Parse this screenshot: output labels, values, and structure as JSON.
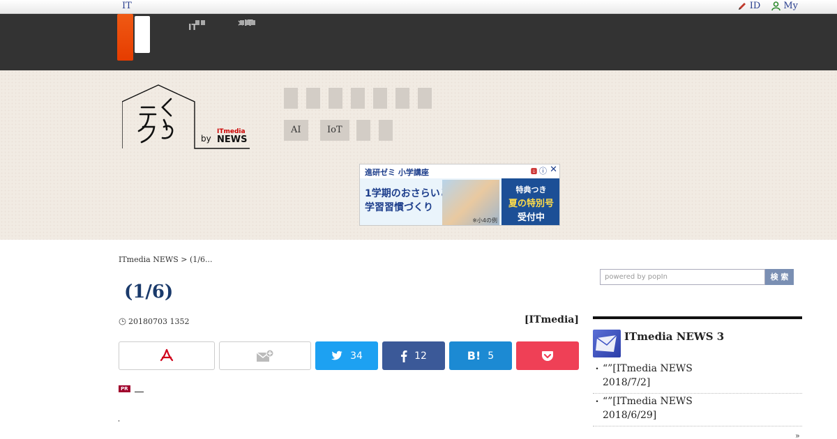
{
  "topbar": {
    "left_link": "IT",
    "id_link": "ID",
    "my_link": "My"
  },
  "nav": {
    "item1_line1": "",
    "item1_line2": "IT",
    "item2_line1": "",
    "item2_line2": "×IT"
  },
  "banner": {
    "logo_text_by": "by",
    "logo_brand_top": "ITmedia",
    "logo_brand_bottom": "NEWS",
    "tags": [
      "AI",
      "IoT"
    ]
  },
  "ad": {
    "title": "進研ゼミ 小学講座",
    "left_line1": "1学期のおさらいと",
    "left_line2": "学習習慣づくり",
    "image_caption": "※小4の例",
    "right_line1": "特典つき",
    "right_line2": "夏の特別号",
    "right_line3": "受付中"
  },
  "article": {
    "breadcrumb_home": "ITmedia NEWS",
    "breadcrumb_sep": ">",
    "breadcrumb_current": "(1/6...",
    "title": "(1/6)",
    "date": "20180703 1352",
    "source": "[ITmedia]"
  },
  "share": {
    "twitter_count": "34",
    "facebook_count": "12",
    "hatena_count": "5",
    "hatena_label": "B!"
  },
  "pr": {
    "badge": "PR"
  },
  "sidebar": {
    "search_placeholder": "powered by popIn",
    "search_button": "検 索",
    "ranking_title": "ITmedia NEWS 3",
    "items": [
      {
        "line1": "“”[ITmedia NEWS",
        "line2": "2018/7/2]"
      },
      {
        "line1": "“”[ITmedia NEWS",
        "line2": "2018/6/29]"
      }
    ],
    "more": "»"
  },
  "colors": {
    "accent_orange": "#e63c00",
    "nav_dark": "#333333",
    "twitter": "#1da1f2",
    "facebook": "#3b5998",
    "hatena": "#1c8ad3",
    "pocket": "#ef4056"
  }
}
